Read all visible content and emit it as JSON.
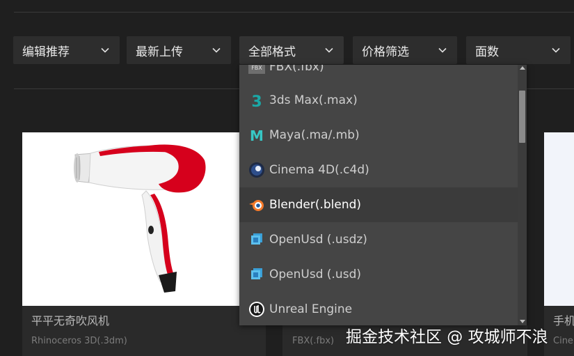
{
  "filters": [
    {
      "label": "编辑推荐"
    },
    {
      "label": "最新上传"
    },
    {
      "label": "全部格式"
    },
    {
      "label": "价格筛选"
    },
    {
      "label": "面数"
    }
  ],
  "format_dropdown": {
    "items": [
      {
        "label": "FBX(.fbx)",
        "icon": "fbx-icon"
      },
      {
        "label": "3ds Max(.max)",
        "icon": "3dsmax-icon"
      },
      {
        "label": "Maya(.ma/.mb)",
        "icon": "maya-icon"
      },
      {
        "label": "Cinema 4D(.c4d)",
        "icon": "cinema4d-icon"
      },
      {
        "label": "Blender(.blend)",
        "icon": "blender-icon",
        "selected": true
      },
      {
        "label": "OpenUsd  (.usdz)",
        "icon": "openusd-icon"
      },
      {
        "label": "OpenUsd  (.usd)",
        "icon": "openusd-icon"
      },
      {
        "label": "Unreal Engine",
        "icon": "unreal-icon"
      }
    ],
    "fbx_icon_text": "FBX",
    "max_icon_text": "3",
    "maya_icon_text": "M"
  },
  "cards": [
    {
      "title": "平平无奇吹风机",
      "format": "Rhinoceros 3D(.3dm)"
    },
    {
      "title": "",
      "format": "FBX(.fbx)"
    },
    {
      "title": "手机",
      "format": "Cine"
    }
  ],
  "watermark": "掘金技术社区 @ 攻城师不浪",
  "colors": {
    "background": "#1f1f1f",
    "filter_bg": "#2d2d2d",
    "dropdown_bg": "#454545",
    "selected_bg": "#3b3b3b",
    "hair_dryer_red": "#d6001c"
  }
}
